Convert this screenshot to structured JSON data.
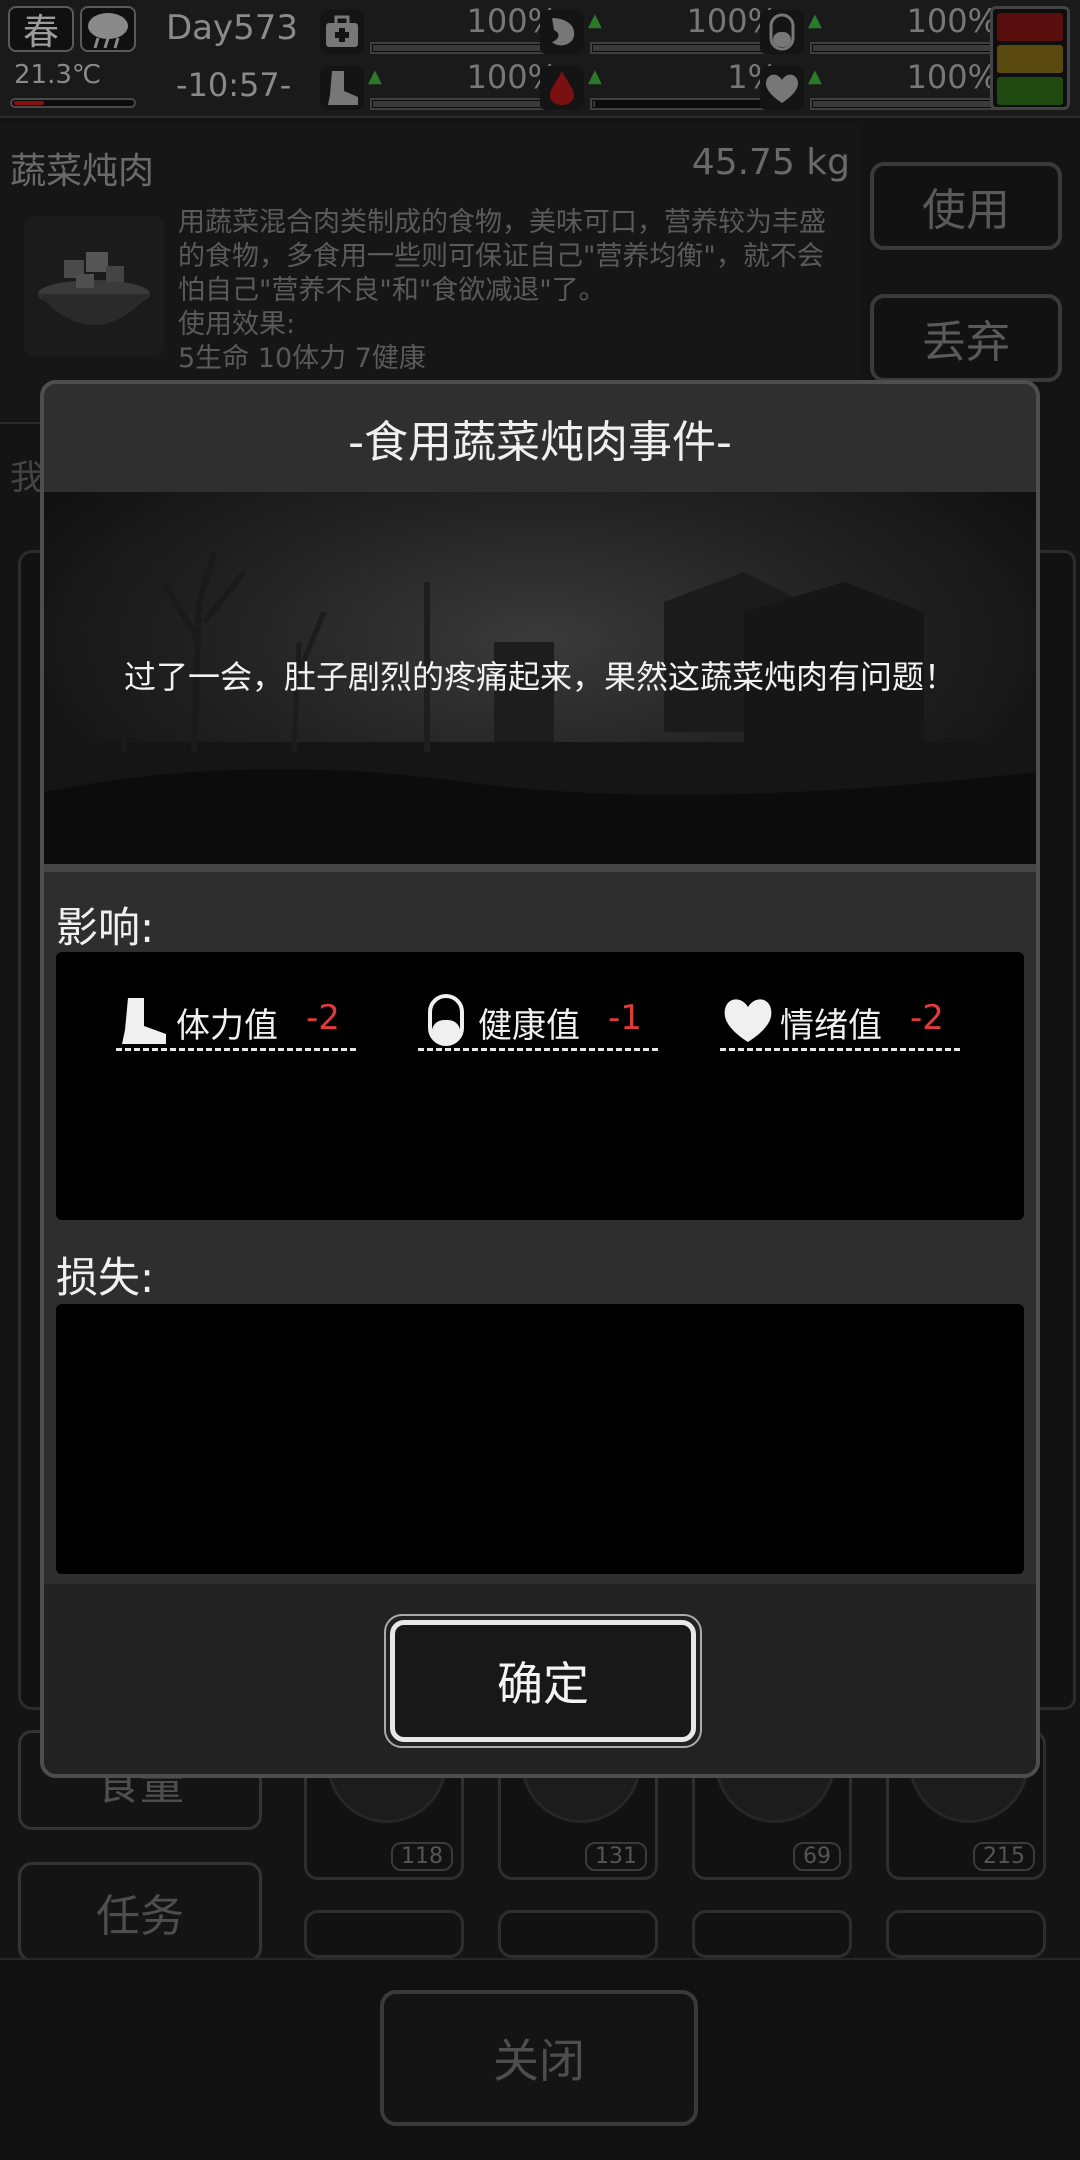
{
  "status": {
    "season": "春",
    "temperature": "21.3℃",
    "temperature_level": 0.25,
    "day": "Day573",
    "time": "-10:57-",
    "stats": [
      {
        "icon": "medkit-icon",
        "value": "100%",
        "level": 1.0
      },
      {
        "icon": "stomach-icon",
        "value": "100%",
        "level": 1.0
      },
      {
        "icon": "capsule-icon",
        "value": "100%",
        "level": 1.0
      },
      {
        "icon": "boot-icon",
        "value": "100%",
        "level": 1.0
      },
      {
        "icon": "blood-drop-icon",
        "value": "1%",
        "level": 0.01
      },
      {
        "icon": "heart-icon",
        "value": "100%",
        "level": 1.0
      }
    ]
  },
  "item": {
    "name": "蔬菜炖肉",
    "weight": "45.75 kg",
    "description": "用蔬菜混合肉类制成的食物，美味可口，营养较为丰盛的食物，多食用一些则可保证自己\"营养均衡\"，就不会怕自己\"营养不良\"和\"食欲减退\"了。",
    "effect_title": "使用效果:",
    "effect_text": "5生命 10体力 7健康",
    "use_label": "使用",
    "discard_label": "丢弃"
  },
  "background": {
    "partial_label": "我",
    "food_tab": "食量",
    "tasks_tab": "任务",
    "slot_counts": [
      "118",
      "131",
      "69",
      "215"
    ],
    "close_label": "关闭"
  },
  "dialog": {
    "title": "-食用蔬菜炖肉事件-",
    "story": "过了一会，肚子剧烈的疼痛起来，果然这蔬菜炖肉有问题！",
    "impact_label": "影响:",
    "effects": [
      {
        "icon": "boot-icon",
        "label": "体力值",
        "value": "-2"
      },
      {
        "icon": "capsule-icon",
        "label": "健康值",
        "value": "-1"
      },
      {
        "icon": "heart-icon",
        "label": "情绪值",
        "value": "-2"
      }
    ],
    "loss_label": "损失:",
    "confirm_label": "确定"
  }
}
